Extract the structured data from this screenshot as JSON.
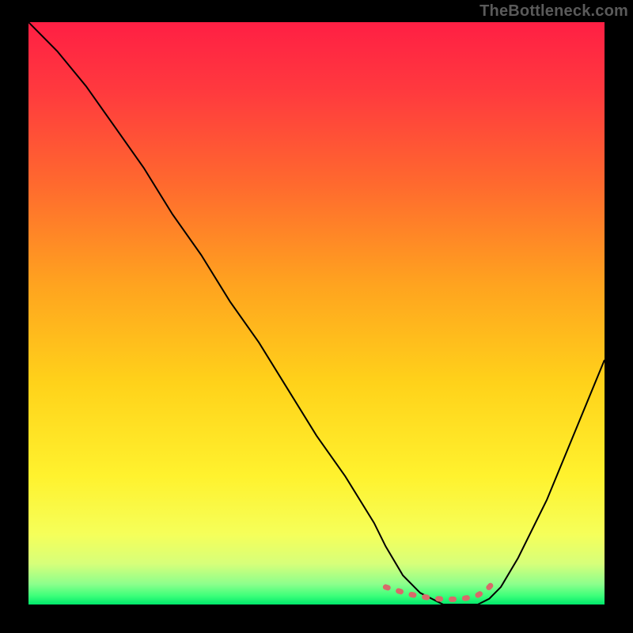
{
  "watermark": "TheBottleneck.com",
  "chart_data": {
    "type": "line",
    "title": "",
    "xlabel": "",
    "ylabel": "",
    "xrange": [
      0,
      100
    ],
    "yrange": [
      0,
      100
    ],
    "grid": false,
    "legend": false,
    "series": [
      {
        "name": "bottleneck-curve",
        "x": [
          0,
          5,
          10,
          15,
          20,
          25,
          30,
          35,
          40,
          45,
          50,
          55,
          60,
          62,
          65,
          68,
          72,
          75,
          78,
          80,
          82,
          85,
          90,
          95,
          100
        ],
        "y": [
          100,
          95,
          89,
          82,
          75,
          67,
          60,
          52,
          45,
          37,
          29,
          22,
          14,
          10,
          5,
          2,
          0,
          0,
          0,
          1,
          3,
          8,
          18,
          30,
          42
        ],
        "stroke": "#000000",
        "stroke_width": 2
      },
      {
        "name": "optimal-band-marker",
        "x": [
          62,
          64,
          66,
          68,
          70,
          72,
          74,
          76,
          78,
          79,
          80,
          81
        ],
        "y": [
          3,
          2.4,
          1.8,
          1.4,
          1.1,
          0.9,
          0.9,
          1.1,
          1.6,
          2.2,
          3.0,
          4.2
        ],
        "stroke": "#d86a6a",
        "stroke_width": 7,
        "dash": "3 14"
      }
    ],
    "background_gradient": {
      "stops": [
        {
          "offset": 0.0,
          "color": "#ff1f44"
        },
        {
          "offset": 0.12,
          "color": "#ff3a3e"
        },
        {
          "offset": 0.28,
          "color": "#ff6a2e"
        },
        {
          "offset": 0.45,
          "color": "#ffa31f"
        },
        {
          "offset": 0.62,
          "color": "#ffd21a"
        },
        {
          "offset": 0.78,
          "color": "#fff22e"
        },
        {
          "offset": 0.88,
          "color": "#f5ff5a"
        },
        {
          "offset": 0.93,
          "color": "#d7ff7a"
        },
        {
          "offset": 0.965,
          "color": "#8cff8c"
        },
        {
          "offset": 0.985,
          "color": "#3dff7a"
        },
        {
          "offset": 1.0,
          "color": "#00e86b"
        }
      ]
    }
  }
}
